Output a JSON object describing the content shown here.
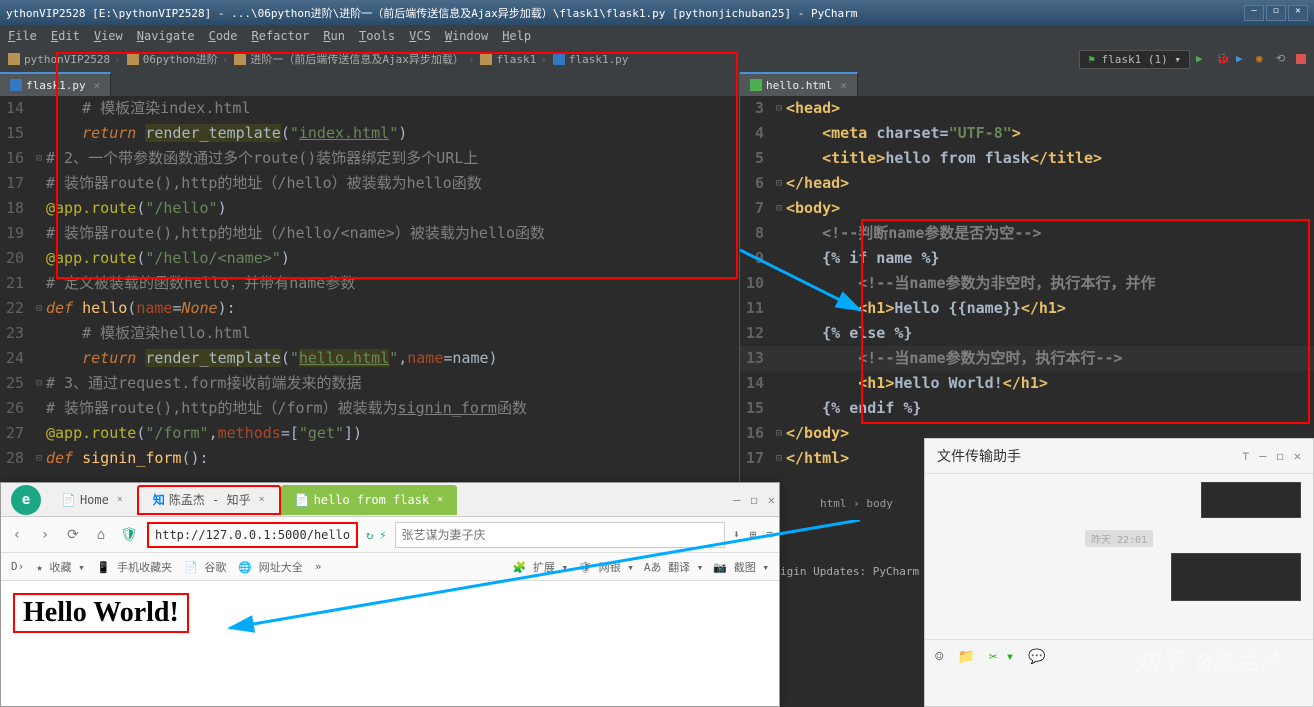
{
  "window": {
    "title": "ythonVIP2528 [E:\\pythonVIP2528] - ...\\06python进阶\\进阶一（前后端传送信息及Ajax异步加载）\\flask1\\flask1.py [pythonjichuban25] - PyCharm"
  },
  "menu": {
    "file": "File",
    "edit": "Edit",
    "view": "View",
    "navigate": "Navigate",
    "code": "Code",
    "refactor": "Refactor",
    "run": "Run",
    "tools": "Tools",
    "vcs": "VCS",
    "window": "Window",
    "help": "Help"
  },
  "breadcrumbs": [
    "pythonVIP2528",
    "06python进阶",
    "进阶一（前后端传送信息及Ajax异步加载）",
    "flask1",
    "flask1.py"
  ],
  "run_config": "flask1 (1)",
  "left_tab": "flask1.py",
  "right_tab": "hello.html",
  "left_code": {
    "l14": {
      "ln": "14",
      "c1": "    # 模板渲染index.html"
    },
    "l15": {
      "ln": "15",
      "kw": "return",
      "fn": "render_template",
      "s": "\"",
      "link": "index.html",
      "end": "\")"
    },
    "l16": {
      "ln": "16",
      "c1": "# 2、一个带参数函数通过多个route()装饰器绑定到多个URL上"
    },
    "l17": {
      "ln": "17",
      "c1": "# 装饰器route(),http的地址（/hello）被装载为hello函数"
    },
    "l18": {
      "ln": "18",
      "dec": "@app.route",
      "s": "(\"/hello\")"
    },
    "l19": {
      "ln": "19",
      "c1": "# 装饰器route(),http的地址（/hello/<name>）被装载为hello函数"
    },
    "l20": {
      "ln": "20",
      "dec": "@app.route",
      "s": "(\"/hello/<name>\")"
    },
    "l21": {
      "ln": "21",
      "c1": "# 定义被装载的函数hello，并带有name参数"
    },
    "l22": {
      "ln": "22",
      "def": "def ",
      "fn": "hello",
      "p1": "(",
      "param": "name",
      "eq": "=",
      "none": "None",
      "p2": "):"
    },
    "l23": {
      "ln": "23",
      "c1": "    # 模板渲染hello.html"
    },
    "l24": {
      "ln": "24",
      "kw": "return",
      "fn": "render_template",
      "s1": "(\"",
      "link": "hello.html",
      "s2": "\",",
      "param": "name",
      "eq": "=",
      "id": "name",
      "end": ")"
    },
    "l25": {
      "ln": "25",
      "c1": "# 3、通过request.form接收前端发来的数据"
    },
    "l26": {
      "ln": "26",
      "c1": "# 装饰器route(),http的地址（/form）被装载为",
      "link": "signin_form",
      "c2": "函数"
    },
    "l27": {
      "ln": "27",
      "dec": "@app.route",
      "s1": "(\"/form\",",
      "param": "methods",
      "eq": "=",
      "s2": "[\"get\"])"
    },
    "l28": {
      "ln": "28",
      "def": "def ",
      "fn": "signin_form",
      "p": "():"
    }
  },
  "right_code": {
    "l3": {
      "ln": "3",
      "t": "<head>"
    },
    "l4": {
      "ln": "4",
      "pre": "    ",
      "t1": "<meta ",
      "attr": "charset=",
      "v": "\"UTF-8\"",
      "t2": ">"
    },
    "l5": {
      "ln": "5",
      "pre": "    ",
      "t1": "<title>",
      "txt": "hello from flask",
      "t2": "</title>"
    },
    "l6": {
      "ln": "6",
      "t": "</head>"
    },
    "l7": {
      "ln": "7",
      "t": "<body>"
    },
    "l8": {
      "ln": "8",
      "pre": "    ",
      "c": "<!--判断name参数是否为空-->"
    },
    "l9": {
      "ln": "9",
      "pre": "    ",
      "t": "{% if name %}"
    },
    "l10": {
      "ln": "10",
      "pre": "        ",
      "c": "<!--当name参数为非空时，执行本行，并作"
    },
    "l11": {
      "ln": "11",
      "pre": "        ",
      "t1": "<h1>",
      "txt": "Hello {{name}}",
      "t2": "</h1>"
    },
    "l12": {
      "ln": "12",
      "pre": "    ",
      "t": "{% else %}"
    },
    "l13": {
      "ln": "13",
      "pre": "        ",
      "c": "<!--当name参数为空时，执行本行-->"
    },
    "l14": {
      "ln": "14",
      "pre": "        ",
      "t1": "<h1>",
      "txt": "Hello World!",
      "t2": "</h1>"
    },
    "l15": {
      "ln": "15",
      "pre": "    ",
      "t": "{% endif %}"
    },
    "l16": {
      "ln": "16",
      "t": "</body>"
    },
    "l17": {
      "ln": "17",
      "t": "</html>"
    }
  },
  "right_crumb": {
    "a": "html",
    "b": "body"
  },
  "browser": {
    "tab1": "Home",
    "tab2": "陈孟杰 - 知乎",
    "tab3": "hello from flask",
    "url": "http://127.0.0.1:5000/hello",
    "search_ph": "张艺谋为妻子庆",
    "bm1": "收藏",
    "bm2": "手机收藏夹",
    "bm3": "谷歌",
    "bm4": "网址大全",
    "ext1": "扩展",
    "ext2": "网银",
    "ext3": "翻译",
    "ext4": "截图",
    "output": "Hello World!"
  },
  "wechat": {
    "title": "文件传输助手",
    "time": "昨天 22:01"
  },
  "status": {
    "plugin": "igin Updates: PyCharm"
  },
  "watermark": "知乎 @陈孟杰"
}
